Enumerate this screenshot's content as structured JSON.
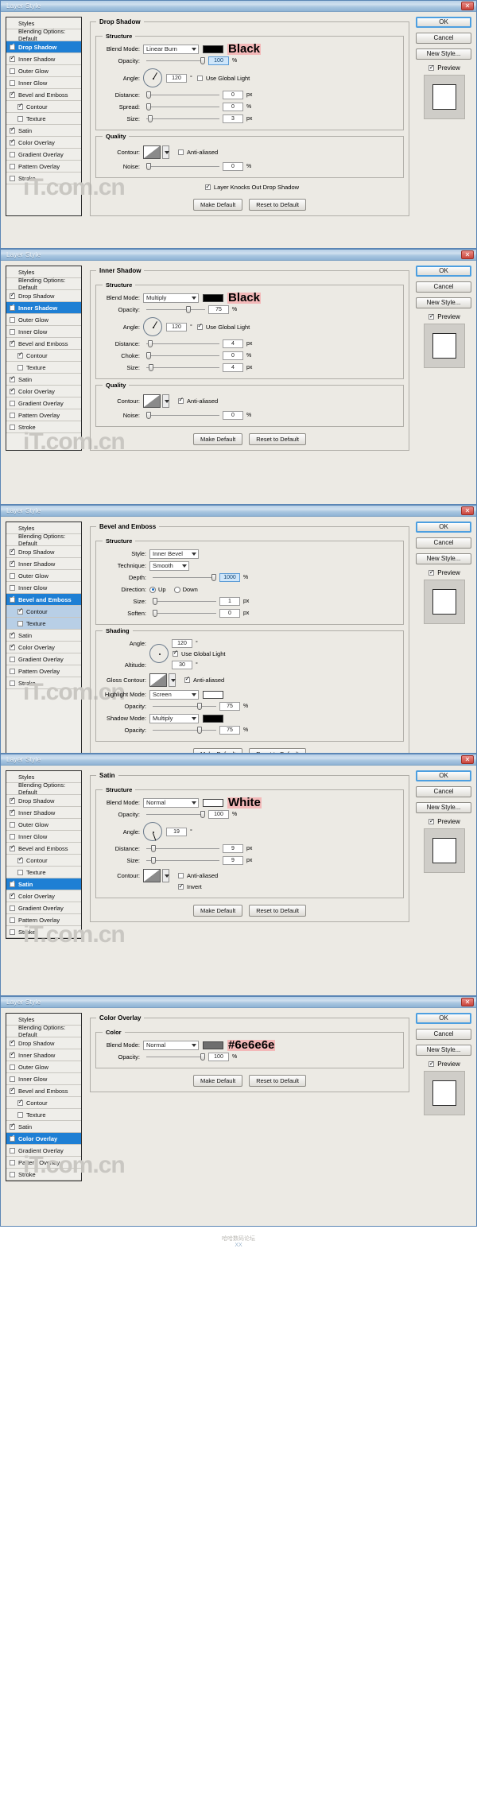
{
  "window": {
    "title": "Layer Style",
    "close_label": "✕"
  },
  "styles_list": [
    {
      "label": "Styles",
      "checkbox": "none",
      "state": "normal",
      "indent": false
    },
    {
      "label": "Blending Options: Default",
      "checkbox": "none",
      "state": "normal",
      "indent": false
    },
    {
      "label": "Drop Shadow",
      "checkbox": "checked",
      "state": "normal",
      "indent": false
    },
    {
      "label": "Inner Shadow",
      "checkbox": "checked",
      "state": "normal",
      "indent": false
    },
    {
      "label": "Outer Glow",
      "checkbox": "unchecked",
      "state": "normal",
      "indent": false
    },
    {
      "label": "Inner Glow",
      "checkbox": "unchecked",
      "state": "normal",
      "indent": false
    },
    {
      "label": "Bevel and Emboss",
      "checkbox": "checked",
      "state": "normal",
      "indent": false
    },
    {
      "label": "Contour",
      "checkbox": "checked",
      "state": "normal",
      "indent": true
    },
    {
      "label": "Texture",
      "checkbox": "unchecked",
      "state": "normal",
      "indent": true
    },
    {
      "label": "Satin",
      "checkbox": "checked",
      "state": "normal",
      "indent": false
    },
    {
      "label": "Color Overlay",
      "checkbox": "checked",
      "state": "normal",
      "indent": false
    },
    {
      "label": "Gradient Overlay",
      "checkbox": "unchecked",
      "state": "normal",
      "indent": false
    },
    {
      "label": "Pattern Overlay",
      "checkbox": "unchecked",
      "state": "normal",
      "indent": false
    },
    {
      "label": "Stroke",
      "checkbox": "unchecked",
      "state": "normal",
      "indent": false
    }
  ],
  "buttons": {
    "ok": "OK",
    "cancel": "Cancel",
    "new_style": "New Style...",
    "preview": "Preview",
    "make_default": "Make Default",
    "reset_default": "Reset to Default"
  },
  "common_labels": {
    "structure": "Structure",
    "quality": "Quality",
    "shading": "Shading",
    "color": "Color",
    "blend_mode": "Blend Mode:",
    "opacity": "Opacity:",
    "angle": "Angle:",
    "distance": "Distance:",
    "spread": "Spread:",
    "size": "Size:",
    "choke": "Choke:",
    "contour": "Contour:",
    "noise": "Noise:",
    "anti_aliased": "Anti-aliased",
    "use_global_light": "Use Global Light",
    "layer_knocks_out": "Layer Knocks Out Drop Shadow",
    "style": "Style:",
    "technique": "Technique:",
    "depth": "Depth:",
    "direction": "Direction:",
    "soften": "Soften:",
    "altitude": "Altitude:",
    "gloss_contour": "Gloss Contour:",
    "highlight_mode": "Highlight Mode:",
    "shadow_mode": "Shadow Mode:",
    "up": "Up",
    "down": "Down",
    "invert": "Invert",
    "pct": "%",
    "px": "px",
    "deg": "°"
  },
  "panels": [
    {
      "id": "drop-shadow",
      "section_title": "Drop Shadow",
      "selected_style": "Drop Shadow",
      "blend_mode": "Linear Burn",
      "color_swatch": "#000000",
      "color_tag": "Black",
      "opacity": "100",
      "opacity_highlighted": true,
      "angle": "120",
      "use_global_light": false,
      "distance": "0",
      "spread": "0",
      "size": "3",
      "anti_aliased": false,
      "noise": "0",
      "layer_knocks_out": true
    },
    {
      "id": "inner-shadow",
      "section_title": "Inner Shadow",
      "selected_style": "Inner Shadow",
      "blend_mode": "Multiply",
      "color_swatch": "#000000",
      "color_tag": "Black",
      "opacity": "75",
      "opacity_highlighted": false,
      "angle": "120",
      "use_global_light": true,
      "distance": "4",
      "choke": "0",
      "size": "4",
      "anti_aliased": true,
      "noise": "0"
    },
    {
      "id": "bevel-emboss",
      "section_title": "Bevel and Emboss",
      "selected_style": "Bevel and Emboss",
      "style": "Inner Bevel",
      "technique": "Smooth",
      "depth": "1000",
      "depth_highlighted": true,
      "direction": "Up",
      "size": "1",
      "soften": "0",
      "angle": "120",
      "use_global_light": true,
      "altitude": "30",
      "gloss_anti_aliased": true,
      "highlight_mode": "Screen",
      "highlight_opacity": "75",
      "shadow_mode": "Multiply",
      "shadow_opacity": "75",
      "shadow_swatch": "#000000"
    },
    {
      "id": "satin",
      "section_title": "Satin",
      "selected_style": "Satin",
      "blend_mode": "Normal",
      "color_swatch": "#ffffff",
      "color_tag": "White",
      "opacity": "100",
      "angle": "19",
      "distance": "9",
      "size": "9",
      "anti_aliased": false,
      "invert": true
    },
    {
      "id": "color-overlay",
      "section_title": "Color Overlay",
      "selected_style": "Color Overlay",
      "blend_mode": "Normal",
      "color_swatch": "#6e6e6e",
      "color_tag": "#6e6e6e",
      "opacity": "100"
    }
  ],
  "watermark": "iT.com.cn",
  "footer": {
    "line1": "哈哈数码论坛",
    "line2": "XX"
  }
}
